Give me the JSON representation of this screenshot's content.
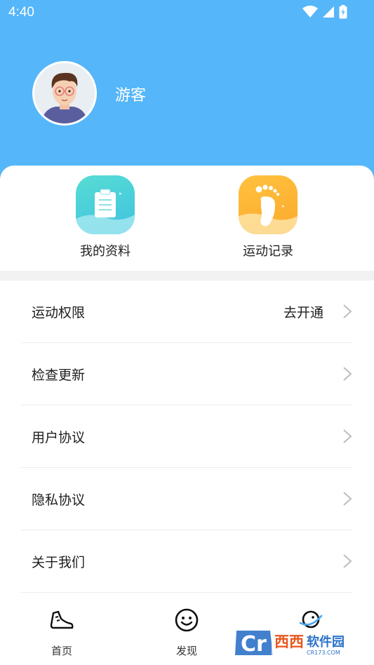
{
  "status_bar": {
    "time": "4:40"
  },
  "profile": {
    "name": "游客"
  },
  "quick_actions": [
    {
      "label": "我的资料",
      "icon": "clipboard-icon",
      "color": "#45cfd4"
    },
    {
      "label": "运动记录",
      "icon": "footprint-icon",
      "color": "#fdb133"
    }
  ],
  "menu": [
    {
      "label": "运动权限",
      "value": "去开通"
    },
    {
      "label": "检查更新"
    },
    {
      "label": "用户协议"
    },
    {
      "label": "隐私协议"
    },
    {
      "label": "关于我们"
    }
  ],
  "tabs": [
    {
      "label": "首页",
      "icon": "sneaker-icon"
    },
    {
      "label": "发现",
      "icon": "smiley-icon"
    },
    {
      "label": "",
      "icon": "planet-icon"
    }
  ],
  "watermark": {
    "text": "西西软件园",
    "subtext": "CR173.COM"
  },
  "colors": {
    "header": "#55b6f9",
    "accent_teal": "#45cfd4",
    "accent_orange": "#fdb133"
  }
}
